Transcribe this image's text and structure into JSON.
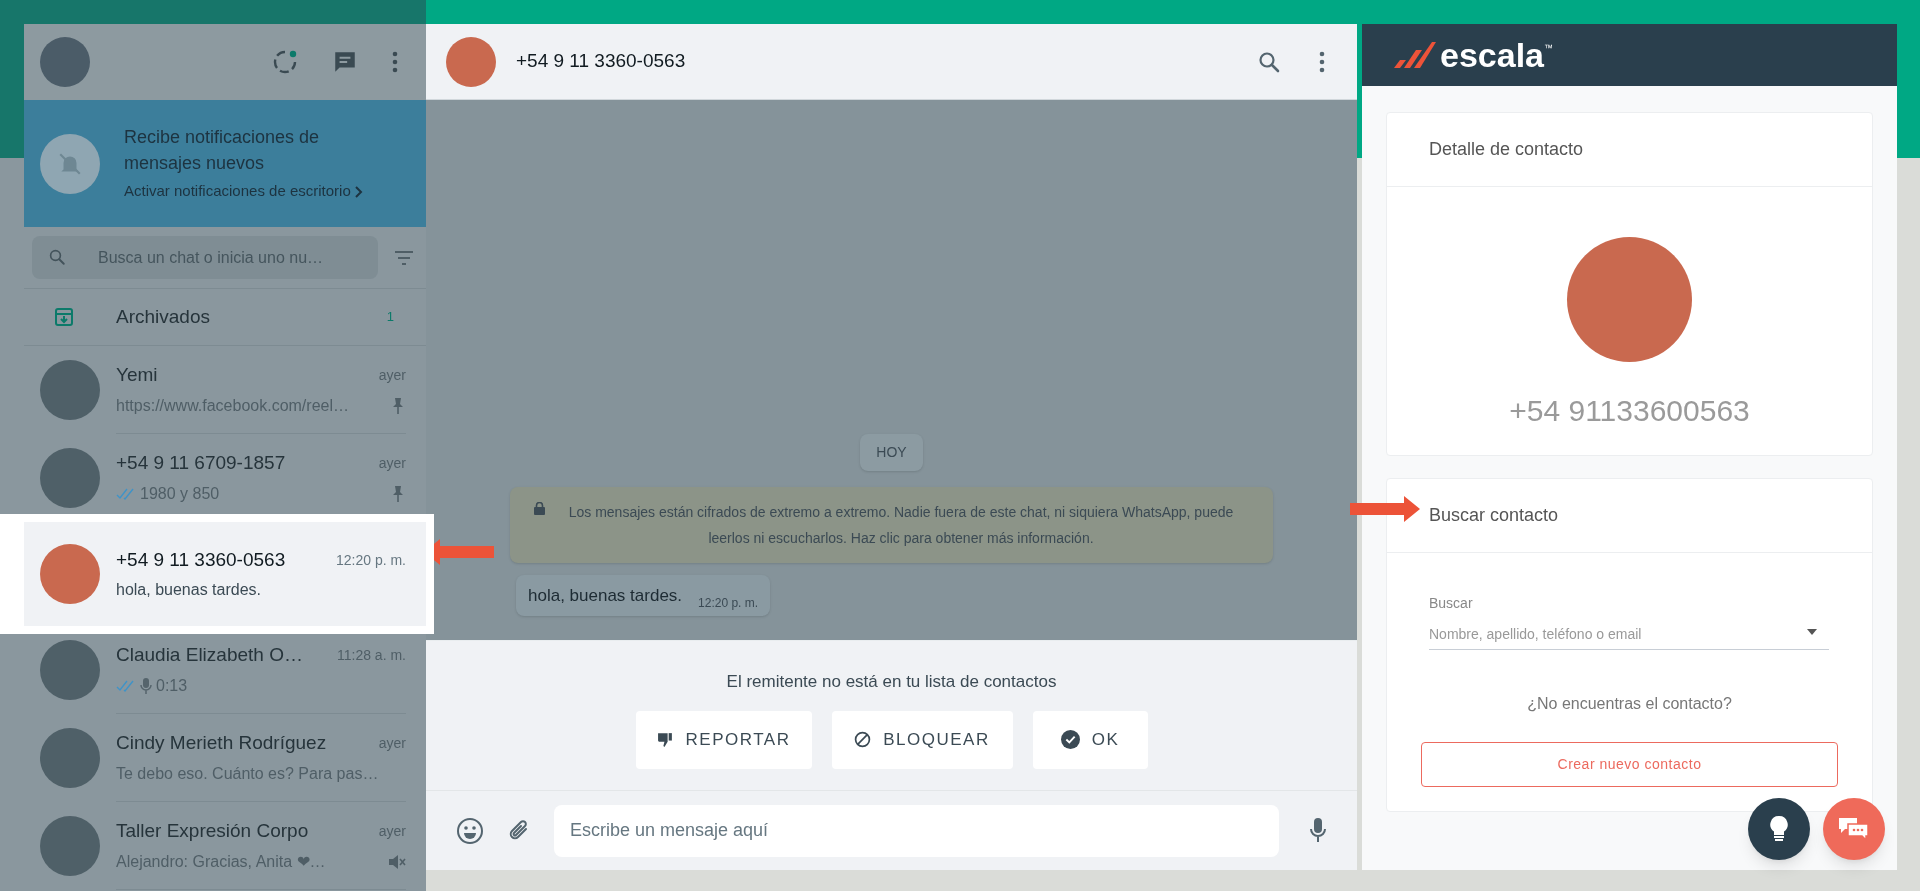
{
  "sidebar": {
    "notification_banner": {
      "title": "Recibe notificaciones de mensajes nuevos",
      "link": "Activar notificaciones de escritorio"
    },
    "search": {
      "placeholder": "Busca un chat o inicia uno nu…"
    },
    "archived": {
      "label": "Archivados",
      "count": "1"
    },
    "chats": [
      {
        "name": "Yemi",
        "time": "ayer",
        "preview": "https://www.facebook.com/reel…",
        "selected": false,
        "read_ticks": false,
        "voice_note": false,
        "pinned": true,
        "muted": false
      },
      {
        "name": "+54 9 11 6709-1857",
        "time": "ayer",
        "preview": "1980 y 850",
        "selected": false,
        "read_ticks": true,
        "voice_note": false,
        "pinned": true,
        "muted": false
      },
      {
        "name": "+54 9 11 3360-0563",
        "time": "12:20 p. m.",
        "preview": "hola, buenas tardes.",
        "selected": true,
        "read_ticks": false,
        "voice_note": false,
        "pinned": false,
        "muted": false
      },
      {
        "name": "Claudia Elizabeth O…",
        "time": "11:28 a. m.",
        "preview": "0:13",
        "selected": false,
        "read_ticks": true,
        "voice_note": true,
        "pinned": false,
        "muted": false
      },
      {
        "name": "Cindy Merieth Rodríguez",
        "time": "ayer",
        "preview": "Te debo eso. Cuánto es? Para pas…",
        "selected": false,
        "read_ticks": false,
        "voice_note": false,
        "pinned": false,
        "muted": false
      },
      {
        "name": "Taller Expresión Corpo",
        "time": "ayer",
        "preview": "Alejandro: Gracias, Anita ❤…",
        "selected": false,
        "read_ticks": false,
        "voice_note": false,
        "pinned": false,
        "muted": true
      }
    ]
  },
  "chat": {
    "title": "+54 9 11 3360-0563",
    "day": "HOY",
    "encryption_notice": "Los mensajes están cifrados de extremo a extremo. Nadie fuera de este chat, ni siquiera WhatsApp, puede leerlos ni escucharlos. Haz clic para obtener más información.",
    "messages": [
      {
        "text": "hola, buenas tardes.",
        "time": "12:20 p. m."
      }
    ],
    "unknown_sender": "El remitente no está en tu lista de contactos",
    "actions": [
      {
        "kind": "report",
        "label": "REPORTAR"
      },
      {
        "kind": "block",
        "label": "BLOQUEAR"
      },
      {
        "kind": "ok",
        "label": "OK"
      }
    ],
    "composer": {
      "placeholder": "Escribe un mensaje aquí"
    }
  },
  "crm": {
    "logo": {
      "text": "escala",
      "mark": "™"
    },
    "contact_detail": {
      "title": "Detalle de contacto",
      "phone": "+54 91133600563"
    },
    "search_contact": {
      "title": "Buscar contacto",
      "field_label": "Buscar",
      "placeholder": "Nombre, apellido, teléfono o email",
      "not_found": "¿No encuentras el contacto?",
      "create_button": "Crear nuevo contacto"
    }
  }
}
